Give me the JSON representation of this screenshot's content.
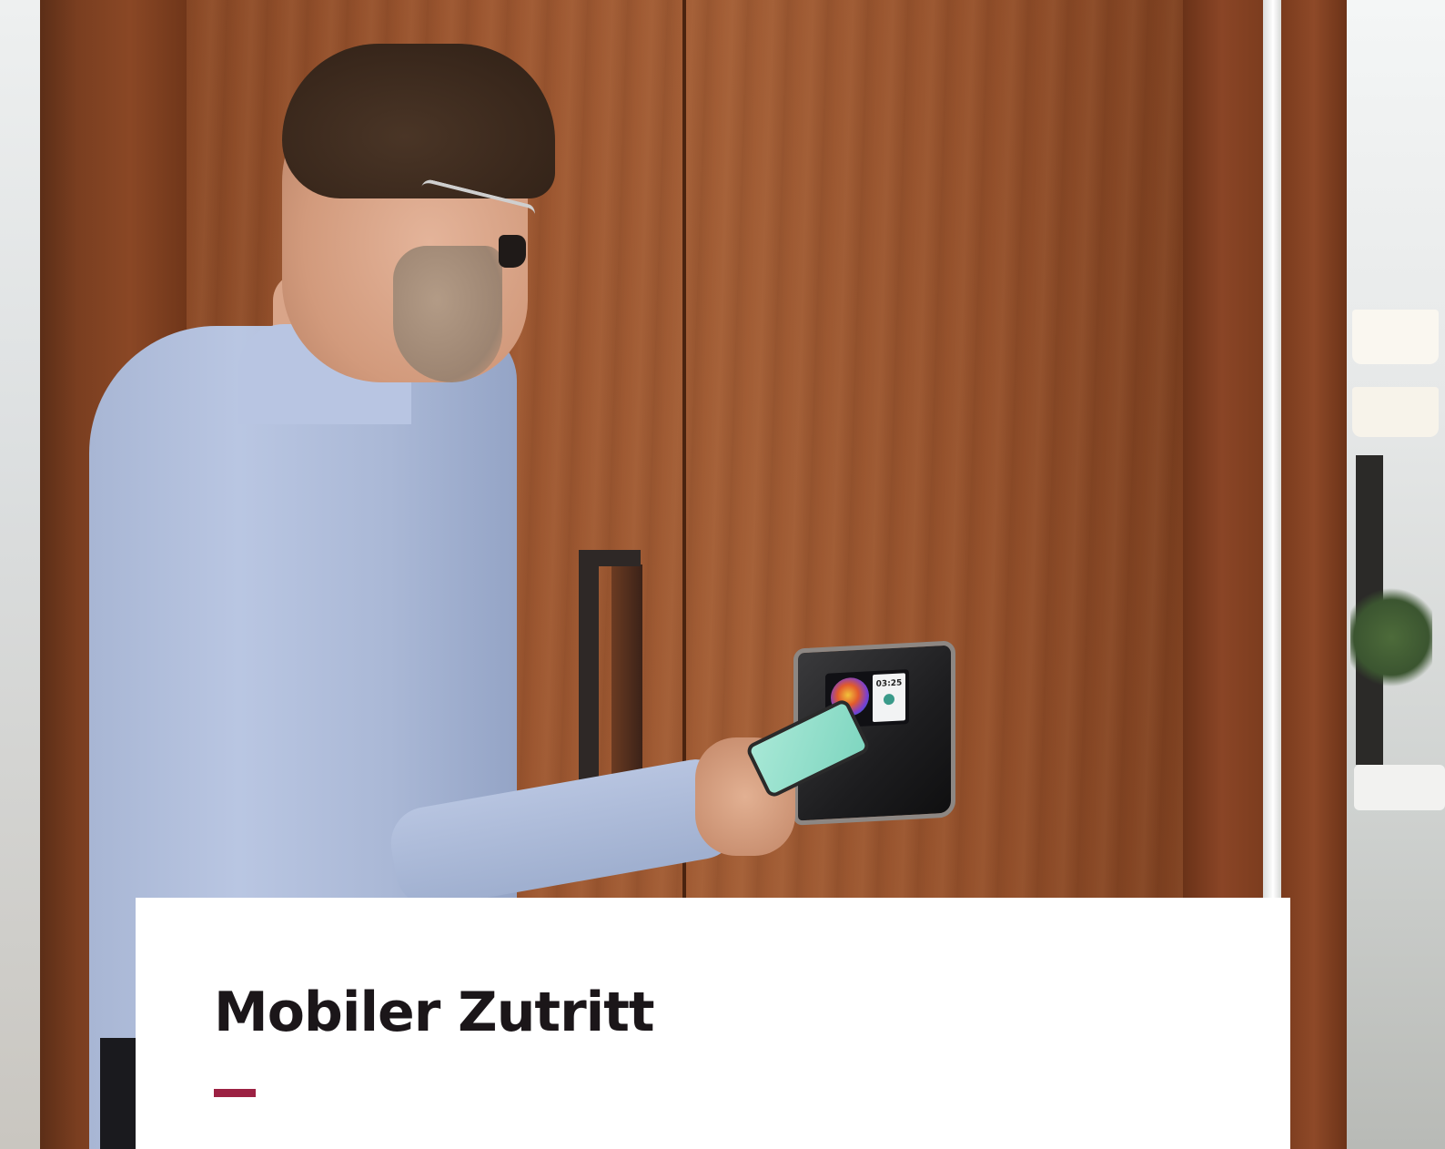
{
  "caption": {
    "title": "Mobiler Zutritt"
  },
  "reader": {
    "time": "03:25"
  },
  "colors": {
    "accent": "#9c2143",
    "title_text": "#1b1619",
    "card_background": "#ffffff"
  }
}
